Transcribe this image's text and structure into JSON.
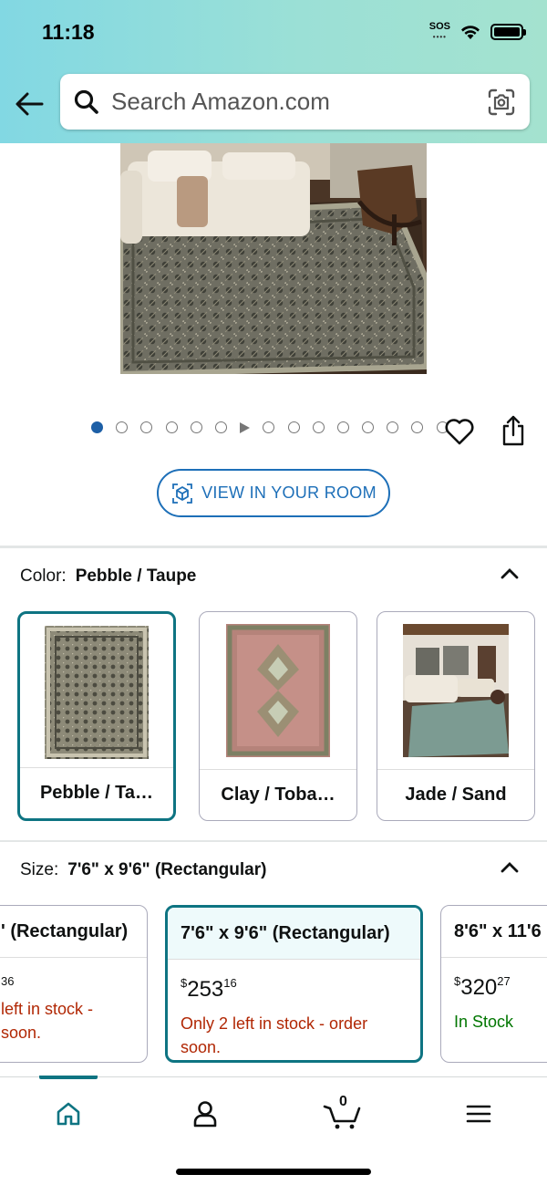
{
  "status_bar": {
    "time": "11:18",
    "sos": "SOS"
  },
  "search": {
    "placeholder": "Search Amazon.com"
  },
  "gallery": {
    "dot_count": 16,
    "active_index": 0,
    "video_index": 6
  },
  "view_in_room": {
    "label": "VIEW IN YOUR ROOM"
  },
  "color": {
    "label": "Color:",
    "selected": "Pebble / Taupe",
    "options": [
      {
        "label": "Pebble / Ta…"
      },
      {
        "label": "Clay / Toba…"
      },
      {
        "label": "Jade / Sand"
      }
    ]
  },
  "size": {
    "label": "Size:",
    "selected": "7'6\" x 9'6\" (Rectangular)",
    "options": [
      {
        "title": "' (Rectangular)",
        "price_whole": "",
        "price_frac": "36",
        "stock": "left in stock -\nsoon.",
        "stock_status": "low"
      },
      {
        "title": "7'6\" x 9'6\" (Rectangular)",
        "price_symbol": "$",
        "price_whole": "253",
        "price_frac": "16",
        "stock": "Only 2 left in stock - order soon.",
        "stock_status": "low"
      },
      {
        "title": "8'6\" x 11'6",
        "price_symbol": "$",
        "price_whole": "320",
        "price_frac": "27",
        "stock": "In Stock",
        "stock_status": "in"
      }
    ]
  },
  "cart": {
    "count": "0"
  },
  "colors": {
    "accent": "#0e7482",
    "link": "#1d6fb8",
    "low_stock": "#b12704",
    "in_stock": "#007600"
  }
}
